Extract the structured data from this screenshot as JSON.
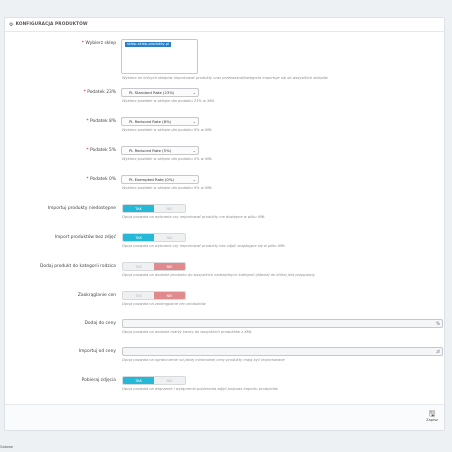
{
  "panel": {
    "title": "KONFIGURACJA PRODUKTÓW"
  },
  "fields": {
    "shops": {
      "label": "Wybierz sklep",
      "selected": "sklep-sklep-produkty-pl",
      "help": "Wybierz do których sklepów importować produkty oraz przekazane/kategorie importuje się do wszystkich sklepów"
    },
    "tax23": {
      "label": "Podatek 23%",
      "value": "PL Standard Rate (23%)",
      "help": "Wybierz podatek w sklepie dla podatku 23% w XML"
    },
    "tax8": {
      "label": "Podatek 8%",
      "value": "PL Reduced Rate (8%)",
      "help": "Wybierz podatek w sklepie dla podatku 8% w XML"
    },
    "tax5": {
      "label": "Podatek 5%",
      "value": "PL Reduced Rate (5%)",
      "help": "Wybierz podatek w sklepie dla podatku 5% w XML"
    },
    "tax0": {
      "label": "Podatek 0%",
      "value": "PL Exempted Rate (0%)",
      "help": "Wybierz podatek w sklepie dla podatku 0% w XML"
    },
    "import_unavailable": {
      "label": "Importuj produkty niedostępne",
      "yes": "TAK",
      "no": "NIE",
      "state": "yes",
      "help": "Opcja pozwala na wybranie czy importować produkty nie dostępne w pliku XML"
    },
    "import_no_images": {
      "label": "Import produktów bez zdjęć",
      "yes": "TAK",
      "no": "NIE",
      "state": "yes",
      "help": "Opcja pozwala na wybranie czy importować produkty bez zdjęć znajdujące się w pliku XML"
    },
    "add_to_parent_category": {
      "label": "Dodaj produkt do kategorii rodzica",
      "yes": "TAK",
      "no": "NIE",
      "state": "no",
      "help": "Opcja pozwala na dodanie produktu do wszystkich nadrzędnych kategorii głównej do której jest przypisany"
    },
    "round_prices": {
      "label": "Zaokrąglanie cen",
      "yes": "TAK",
      "no": "NIE",
      "state": "no",
      "help": "Opcja pozwala na zaokrąglanie cen produktów"
    },
    "add_to_price": {
      "label": "Dodaj do ceny",
      "value": "",
      "icon": "%",
      "help": "Opcja pozwala na dodanie marży kwoty do wszystkich produktów z XML"
    },
    "import_from_price": {
      "label": "Importuj od ceny",
      "value": "",
      "icon": "zł",
      "help": "Opcja pozwala na ograniczenie od jakiej minimalnej ceny produkty mają być importowane"
    },
    "download_images": {
      "label": "Pobieraj zdjęcia",
      "yes": "TAK",
      "no": "NIE",
      "state": "yes",
      "help": "Opcja pozwala na włączenie i wyłączenie pobierania zdjęć podczas importu produktów"
    }
  },
  "footer": {
    "save_label": "Zapisz"
  },
  "status": "Gotowe"
}
